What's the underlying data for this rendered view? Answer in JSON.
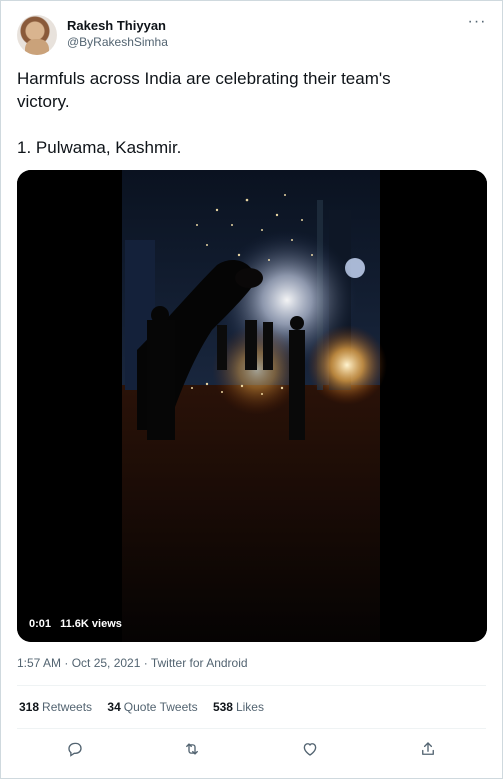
{
  "author": {
    "name": "Rakesh Thiyyan",
    "handle": "@ByRakeshSimha"
  },
  "menu": {
    "more_glyph": "···"
  },
  "tweet": {
    "text": "Harmfuls across India are celebrating their team's\nvictory.\n\n1. Pulwama, Kashmir."
  },
  "video": {
    "time": "0:01",
    "views": "11.6K views"
  },
  "meta": {
    "timestamp": "1:57 AM · Oct 25, 2021 · Twitter for Android"
  },
  "stats": {
    "retweets_count": "318",
    "retweets_label": "Retweets",
    "quotes_count": "34",
    "quotes_label": "Quote Tweets",
    "likes_count": "538",
    "likes_label": "Likes"
  },
  "actions": [
    "reply-icon",
    "retweet-icon",
    "like-icon",
    "share-icon"
  ],
  "colors": {
    "text": "#0f1419",
    "secondary": "#536471",
    "border": "#cfd9de",
    "divider": "#eff3f4"
  }
}
